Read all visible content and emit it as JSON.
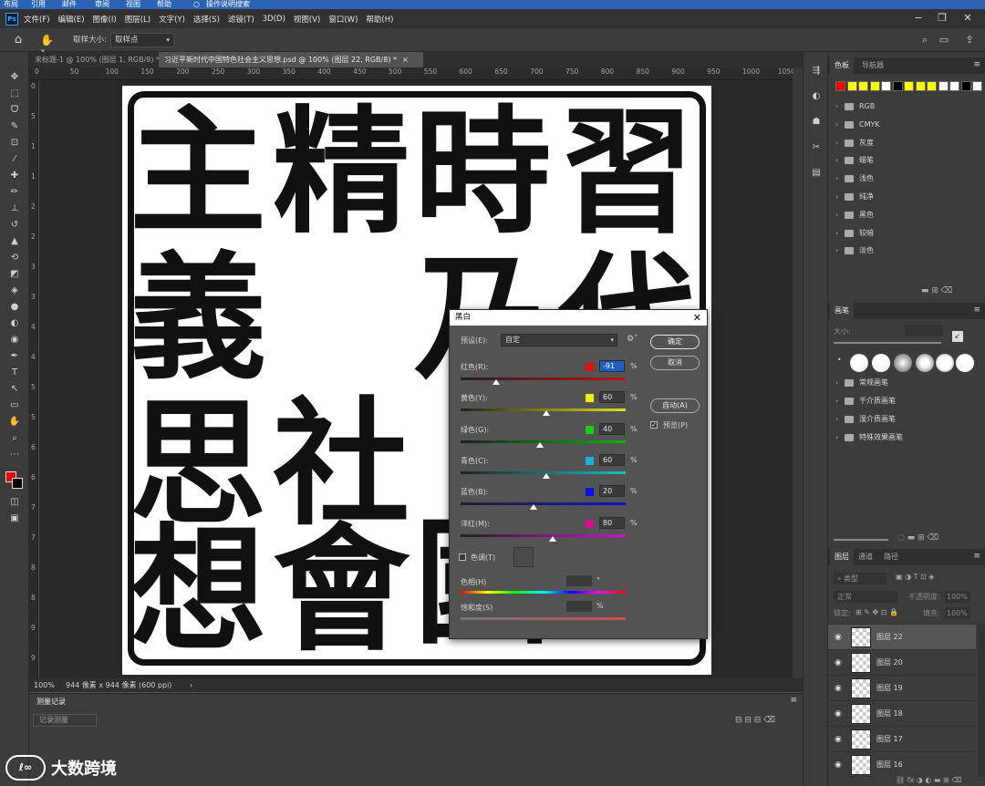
{
  "top_strip": [
    "布局",
    "引用",
    "邮件",
    "审阅",
    "视图",
    "帮助",
    "操作说明搜索"
  ],
  "menubar": {
    "logo": "Ps",
    "items": [
      "文件(F)",
      "编辑(E)",
      "图像(I)",
      "图层(L)",
      "文字(Y)",
      "选择(S)",
      "滤镜(T)",
      "3D(D)",
      "视图(V)",
      "窗口(W)",
      "帮助(H)"
    ]
  },
  "options_bar": {
    "sample_size_label": "取样大小:",
    "sample_size_value": "取样点"
  },
  "doc_tabs": [
    {
      "label": "未标题-1 @ 100% (图层 1, RGB/8) *",
      "active": false
    },
    {
      "label": "习近平新时代中国特色社会主义思想.psd @ 100% (图层 22, RGB/8) *",
      "active": true
    }
  ],
  "ruler_ticks": [
    "0",
    "50",
    "100",
    "150",
    "200",
    "250",
    "300",
    "350",
    "400",
    "450",
    "500",
    "550",
    "600",
    "650",
    "700",
    "750",
    "800",
    "850",
    "900",
    "950",
    "1000",
    "1050"
  ],
  "ruler_left_ticks": [
    "0",
    "5",
    "1",
    "1",
    "2",
    "2",
    "3",
    "3",
    "4",
    "4",
    "5",
    "5",
    "6",
    "6",
    "7",
    "7",
    "8",
    "8",
    "9",
    "9"
  ],
  "canvas_glyphs": [
    "習",
    "時",
    "精",
    "主",
    "代",
    "乃",
    "義",
    "社",
    "會",
    "思",
    "想",
    "國"
  ],
  "status_bar": {
    "zoom": "100%",
    "doc_info": "944 像素 x 944 像素 (600 ppi)"
  },
  "history_panel": {
    "tab": "测量记录",
    "item": "记录测量"
  },
  "watermark": {
    "logo": "ℓ∞",
    "text": "大数跨境"
  },
  "swatches_panel": {
    "tabs": [
      "色板",
      "导航器"
    ],
    "colors": [
      "#ff0000",
      "#ffff00",
      "#ffff00",
      "#ffff00",
      "#ffffff",
      "#000000",
      "#ffff00",
      "#ffff00",
      "#ffff00",
      "#ffffff",
      "#ffffff",
      "#000000",
      "#ffffff"
    ],
    "folders": [
      "RGB",
      "CMYK",
      "灰度",
      "蜡笔",
      "浅色",
      "纯净",
      "黑色",
      "较暗",
      "淡色"
    ]
  },
  "brush_panel": {
    "tabs": [
      "画笔"
    ],
    "size_label": "大小:",
    "folders": [
      "常规画笔",
      "干介质画笔",
      "湿介质画笔",
      "特殊效果画笔"
    ]
  },
  "layers_panel": {
    "tabs": [
      "图层",
      "通道",
      "路径"
    ],
    "filter_label": "类型",
    "blend_mode": "正常",
    "opacity_label": "不透明度:",
    "opacity_value": "100%",
    "lock_label": "锁定:",
    "fill_label": "填充:",
    "fill_value": "100%",
    "layers": [
      {
        "name": "图层 22",
        "selected": true
      },
      {
        "name": "图层 20",
        "selected": false
      },
      {
        "name": "图层 19",
        "selected": false
      },
      {
        "name": "图层 18",
        "selected": false
      },
      {
        "name": "图层 17",
        "selected": false
      },
      {
        "name": "图层 16",
        "selected": false
      }
    ]
  },
  "bw_dialog": {
    "title": "黑白",
    "preset_label": "预设(E):",
    "preset_value": "自定",
    "ok": "确定",
    "cancel": "取消",
    "auto": "自动(A)",
    "preview_label": "预览(P)",
    "preview_checked": true,
    "sliders": [
      {
        "label": "红色(R):",
        "value": "-91",
        "swatch": "#e01010",
        "numeric": -91,
        "highlighted": true,
        "gradient": "linear-gradient(to right,#202020,#c21010)"
      },
      {
        "label": "黄色(Y):",
        "value": "60",
        "swatch": "#f0f010",
        "numeric": 60,
        "highlighted": false,
        "gradient": "linear-gradient(to right,#202020,#e0e010)"
      },
      {
        "label": "绿色(G):",
        "value": "40",
        "swatch": "#10d010",
        "numeric": 40,
        "highlighted": false,
        "gradient": "linear-gradient(to right,#202020,#10b010)"
      },
      {
        "label": "青色(C):",
        "value": "60",
        "swatch": "#1ab0d8",
        "numeric": 60,
        "highlighted": false,
        "gradient": "linear-gradient(to right,#202020,#10c0c0)"
      },
      {
        "label": "蓝色(B):",
        "value": "20",
        "swatch": "#1010e0",
        "numeric": 20,
        "highlighted": false,
        "gradient": "linear-gradient(to right,#202020,#1010d0)"
      },
      {
        "label": "洋红(M):",
        "value": "80",
        "swatch": "#d01090",
        "numeric": 80,
        "highlighted": false,
        "gradient": "linear-gradient(to right,#202020,#d010d0)"
      }
    ],
    "slider_range": [
      -200,
      300
    ],
    "tint_label": "色调(T)",
    "hue_label": "色相(H)",
    "hue_unit": "°",
    "saturation_label": "饱和度(S)",
    "saturation_unit": "%",
    "percent": "%"
  }
}
